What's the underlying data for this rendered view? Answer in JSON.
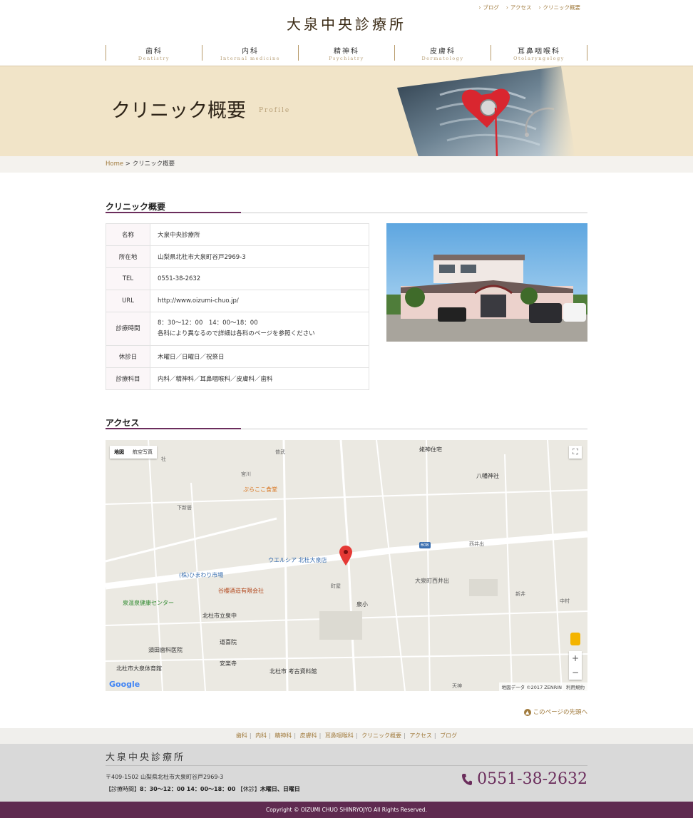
{
  "header": {
    "top_links": [
      "ブログ",
      "アクセス",
      "クリニック概要"
    ],
    "logo": "大泉中央診療所",
    "nav": [
      {
        "jp": "歯科",
        "en": "Dentistry"
      },
      {
        "jp": "内科",
        "en": "Internal medicine"
      },
      {
        "jp": "精神科",
        "en": "Psychiatry"
      },
      {
        "jp": "皮膚科",
        "en": "Dermatology"
      },
      {
        "jp": "耳鼻咽喉科",
        "en": "Otolaryngology"
      }
    ]
  },
  "hero": {
    "title": "クリニック概要",
    "subtitle": "Profile"
  },
  "breadcrumb": {
    "home": "Home",
    "sep": " > ",
    "current": "クリニック概要"
  },
  "profile": {
    "heading": "クリニック概要",
    "rows": [
      {
        "key": "名称",
        "value": "大泉中央診療所"
      },
      {
        "key": "所在地",
        "value": "山梨県北杜市大泉町谷戸2969-3"
      },
      {
        "key": "TEL",
        "value": "0551-38-2632"
      },
      {
        "key": "URL",
        "value": "http://www.oizumi-chuo.jp/"
      },
      {
        "key": "診療時間",
        "value": "8：30～12：00　14：00～18：00",
        "value2": "各科により異なるので詳細は各科のページを参照ください"
      },
      {
        "key": "休診日",
        "value": "木曜日／日曜日／祝祭日"
      },
      {
        "key": "診療科目",
        "value": "内科／精神科／耳鼻咽喉科／皮膚科／歯科"
      }
    ]
  },
  "access": {
    "heading": "アクセス",
    "map": {
      "type_tabs": [
        "地図",
        "航空写真"
      ],
      "labels": [
        "姥神住宅",
        "八幡神社",
        "ぷらここ食堂",
        "ウエルシア 北杜大泉店",
        "(株)ひまわり市場",
        "谷櫻酒造有限会社",
        "泉温泉健康センター",
        "北杜市立泉中",
        "大泉町西井出",
        "泉小",
        "道喜院",
        "安楽寺",
        "須田歯科医院",
        "北杜市大泉体育館",
        "北杜市 考古資料館",
        "西井出",
        "下新居",
        "新井",
        "中村",
        "町屋",
        "宮川",
        "普武",
        "天神",
        "社",
        "608"
      ],
      "google": "Google",
      "attribution": [
        "地図データ ©2017 ZENRIN",
        "利用規約"
      ],
      "zoom_in": "+",
      "zoom_out": "−"
    }
  },
  "to_top": "このページの先頭へ",
  "footer": {
    "nav": [
      "歯科",
      "内科",
      "精神科",
      "皮膚科",
      "耳鼻咽喉科",
      "クリニック概要",
      "アクセス",
      "ブログ"
    ],
    "logo": "大泉中央診療所",
    "address": "〒409-1502 山梨県北杜市大泉町谷戸2969-3",
    "hours_label": "【診療時間】",
    "hours": "8：30～12：00 14：00～18：00",
    "closed_label": "【休診】",
    "closed": "木曜日、日曜日",
    "tel": "0551-38-2632",
    "copyright": "Copyright © OIZUMI CHUO SHINRYOJYO All Rights Reserved."
  },
  "colors": {
    "accent": "#6b2d5c",
    "gold": "#a07a3c",
    "hero_bg": "#f1e4c8"
  }
}
